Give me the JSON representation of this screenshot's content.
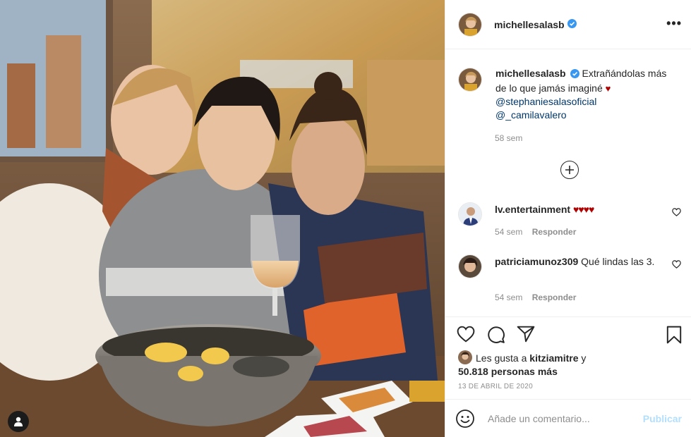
{
  "post": {
    "username": "michellesalasb",
    "verified": true,
    "more_label": "•••"
  },
  "caption": {
    "username": "michellesalasb",
    "text": "Extrañándolas más de lo que jamás imaginé",
    "heart": "♥",
    "mentions": [
      "@stephaniesalasoficial",
      "@_camilavalero"
    ],
    "time": "58 sem"
  },
  "load_more_icon": "plus-circle-icon",
  "comments": [
    {
      "username": "lv.entertainment",
      "text": "♥♥♥♥",
      "time": "54 sem",
      "reply": "Responder"
    },
    {
      "username": "patriciamunoz309",
      "text": "Qué lindas las 3.",
      "time": "54 sem",
      "reply": "Responder"
    }
  ],
  "actions": {
    "icons": [
      "heart-icon",
      "comment-icon",
      "share-icon",
      "save-icon"
    ]
  },
  "likes": {
    "prefix": "Les gusta a",
    "user": "kitziamitre",
    "connector": "y",
    "others": "50.818 personas más"
  },
  "date": "13 DE ABRIL DE 2020",
  "comment_box": {
    "placeholder": "Añade un comentario...",
    "publish_label": "Publicar"
  },
  "colors": {
    "accent_blue": "#0095f6",
    "publish_disabled": "#b2dffc",
    "verified_blue": "#3897f0",
    "heart_red": "#b00000",
    "mention_blue": "#00376b"
  }
}
